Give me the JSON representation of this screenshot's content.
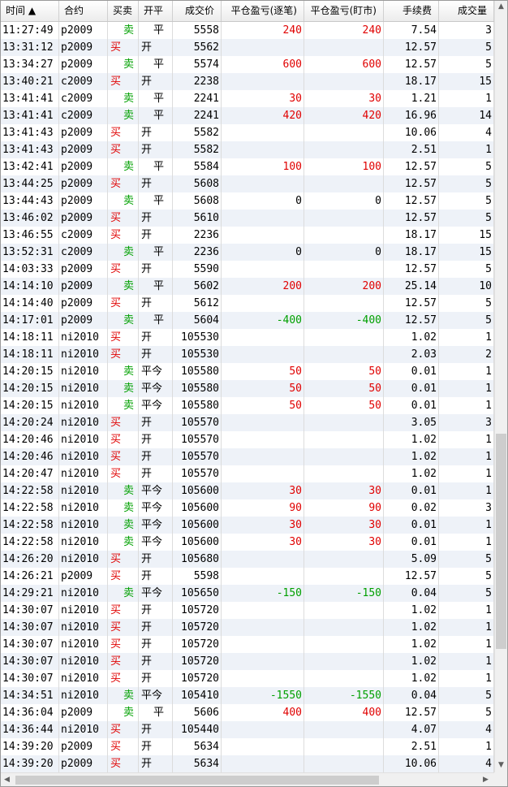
{
  "table": {
    "columns": [
      "时间 ▲",
      "合约",
      "买卖",
      "开平",
      "成交价",
      "平仓盈亏(逐笔)",
      "平仓盈亏(盯市)",
      "手续费",
      "成交量"
    ],
    "rows": [
      [
        "11:27:49",
        "p2009",
        "卖",
        "平",
        "5558",
        "240",
        "240",
        "7.54",
        "3"
      ],
      [
        "13:31:12",
        "p2009",
        "买",
        "开",
        "5562",
        "",
        "",
        "12.57",
        "5"
      ],
      [
        "13:34:27",
        "p2009",
        "卖",
        "平",
        "5574",
        "600",
        "600",
        "12.57",
        "5"
      ],
      [
        "13:40:21",
        "c2009",
        "买",
        "开",
        "2238",
        "",
        "",
        "18.17",
        "15"
      ],
      [
        "13:41:41",
        "c2009",
        "卖",
        "平",
        "2241",
        "30",
        "30",
        "1.21",
        "1"
      ],
      [
        "13:41:41",
        "c2009",
        "卖",
        "平",
        "2241",
        "420",
        "420",
        "16.96",
        "14"
      ],
      [
        "13:41:43",
        "p2009",
        "买",
        "开",
        "5582",
        "",
        "",
        "10.06",
        "4"
      ],
      [
        "13:41:43",
        "p2009",
        "买",
        "开",
        "5582",
        "",
        "",
        "2.51",
        "1"
      ],
      [
        "13:42:41",
        "p2009",
        "卖",
        "平",
        "5584",
        "100",
        "100",
        "12.57",
        "5"
      ],
      [
        "13:44:25",
        "p2009",
        "买",
        "开",
        "5608",
        "",
        "",
        "12.57",
        "5"
      ],
      [
        "13:44:43",
        "p2009",
        "卖",
        "平",
        "5608",
        "0",
        "0",
        "12.57",
        "5"
      ],
      [
        "13:46:02",
        "p2009",
        "买",
        "开",
        "5610",
        "",
        "",
        "12.57",
        "5"
      ],
      [
        "13:46:55",
        "c2009",
        "买",
        "开",
        "2236",
        "",
        "",
        "18.17",
        "15"
      ],
      [
        "13:52:31",
        "c2009",
        "卖",
        "平",
        "2236",
        "0",
        "0",
        "18.17",
        "15"
      ],
      [
        "14:03:33",
        "p2009",
        "买",
        "开",
        "5590",
        "",
        "",
        "12.57",
        "5"
      ],
      [
        "14:14:10",
        "p2009",
        "卖",
        "平",
        "5602",
        "200",
        "200",
        "25.14",
        "10"
      ],
      [
        "14:14:40",
        "p2009",
        "买",
        "开",
        "5612",
        "",
        "",
        "12.57",
        "5"
      ],
      [
        "14:17:01",
        "p2009",
        "卖",
        "平",
        "5604",
        "-400",
        "-400",
        "12.57",
        "5"
      ],
      [
        "14:18:11",
        "ni2010",
        "买",
        "开",
        "105530",
        "",
        "",
        "1.02",
        "1"
      ],
      [
        "14:18:11",
        "ni2010",
        "买",
        "开",
        "105530",
        "",
        "",
        "2.03",
        "2"
      ],
      [
        "14:20:15",
        "ni2010",
        "卖",
        "平今",
        "105580",
        "50",
        "50",
        "0.01",
        "1"
      ],
      [
        "14:20:15",
        "ni2010",
        "卖",
        "平今",
        "105580",
        "50",
        "50",
        "0.01",
        "1"
      ],
      [
        "14:20:15",
        "ni2010",
        "卖",
        "平今",
        "105580",
        "50",
        "50",
        "0.01",
        "1"
      ],
      [
        "14:20:24",
        "ni2010",
        "买",
        "开",
        "105570",
        "",
        "",
        "3.05",
        "3"
      ],
      [
        "14:20:46",
        "ni2010",
        "买",
        "开",
        "105570",
        "",
        "",
        "1.02",
        "1"
      ],
      [
        "14:20:46",
        "ni2010",
        "买",
        "开",
        "105570",
        "",
        "",
        "1.02",
        "1"
      ],
      [
        "14:20:47",
        "ni2010",
        "买",
        "开",
        "105570",
        "",
        "",
        "1.02",
        "1"
      ],
      [
        "14:22:58",
        "ni2010",
        "卖",
        "平今",
        "105600",
        "30",
        "30",
        "0.01",
        "1"
      ],
      [
        "14:22:58",
        "ni2010",
        "卖",
        "平今",
        "105600",
        "90",
        "90",
        "0.02",
        "3"
      ],
      [
        "14:22:58",
        "ni2010",
        "卖",
        "平今",
        "105600",
        "30",
        "30",
        "0.01",
        "1"
      ],
      [
        "14:22:58",
        "ni2010",
        "卖",
        "平今",
        "105600",
        "30",
        "30",
        "0.01",
        "1"
      ],
      [
        "14:26:20",
        "ni2010",
        "买",
        "开",
        "105680",
        "",
        "",
        "5.09",
        "5"
      ],
      [
        "14:26:21",
        "p2009",
        "买",
        "开",
        "5598",
        "",
        "",
        "12.57",
        "5"
      ],
      [
        "14:29:21",
        "ni2010",
        "卖",
        "平今",
        "105650",
        "-150",
        "-150",
        "0.04",
        "5"
      ],
      [
        "14:30:07",
        "ni2010",
        "买",
        "开",
        "105720",
        "",
        "",
        "1.02",
        "1"
      ],
      [
        "14:30:07",
        "ni2010",
        "买",
        "开",
        "105720",
        "",
        "",
        "1.02",
        "1"
      ],
      [
        "14:30:07",
        "ni2010",
        "买",
        "开",
        "105720",
        "",
        "",
        "1.02",
        "1"
      ],
      [
        "14:30:07",
        "ni2010",
        "买",
        "开",
        "105720",
        "",
        "",
        "1.02",
        "1"
      ],
      [
        "14:30:07",
        "ni2010",
        "买",
        "开",
        "105720",
        "",
        "",
        "1.02",
        "1"
      ],
      [
        "14:34:51",
        "ni2010",
        "卖",
        "平今",
        "105410",
        "-1550",
        "-1550",
        "0.04",
        "5"
      ],
      [
        "14:36:04",
        "p2009",
        "卖",
        "平",
        "5606",
        "400",
        "400",
        "12.57",
        "5"
      ],
      [
        "14:36:44",
        "ni2010",
        "买",
        "开",
        "105440",
        "",
        "",
        "4.07",
        "4"
      ],
      [
        "14:39:20",
        "p2009",
        "买",
        "开",
        "5634",
        "",
        "",
        "2.51",
        "1"
      ],
      [
        "14:39:20",
        "p2009",
        "买",
        "开",
        "5634",
        "",
        "",
        "10.06",
        "4"
      ]
    ]
  },
  "colors": {
    "buy": "#e00000",
    "sell": "#00a000",
    "row_alt": "#eef2f8"
  },
  "scroll": {
    "vertical_position": 0.72,
    "horizontal_position": 0.0
  }
}
